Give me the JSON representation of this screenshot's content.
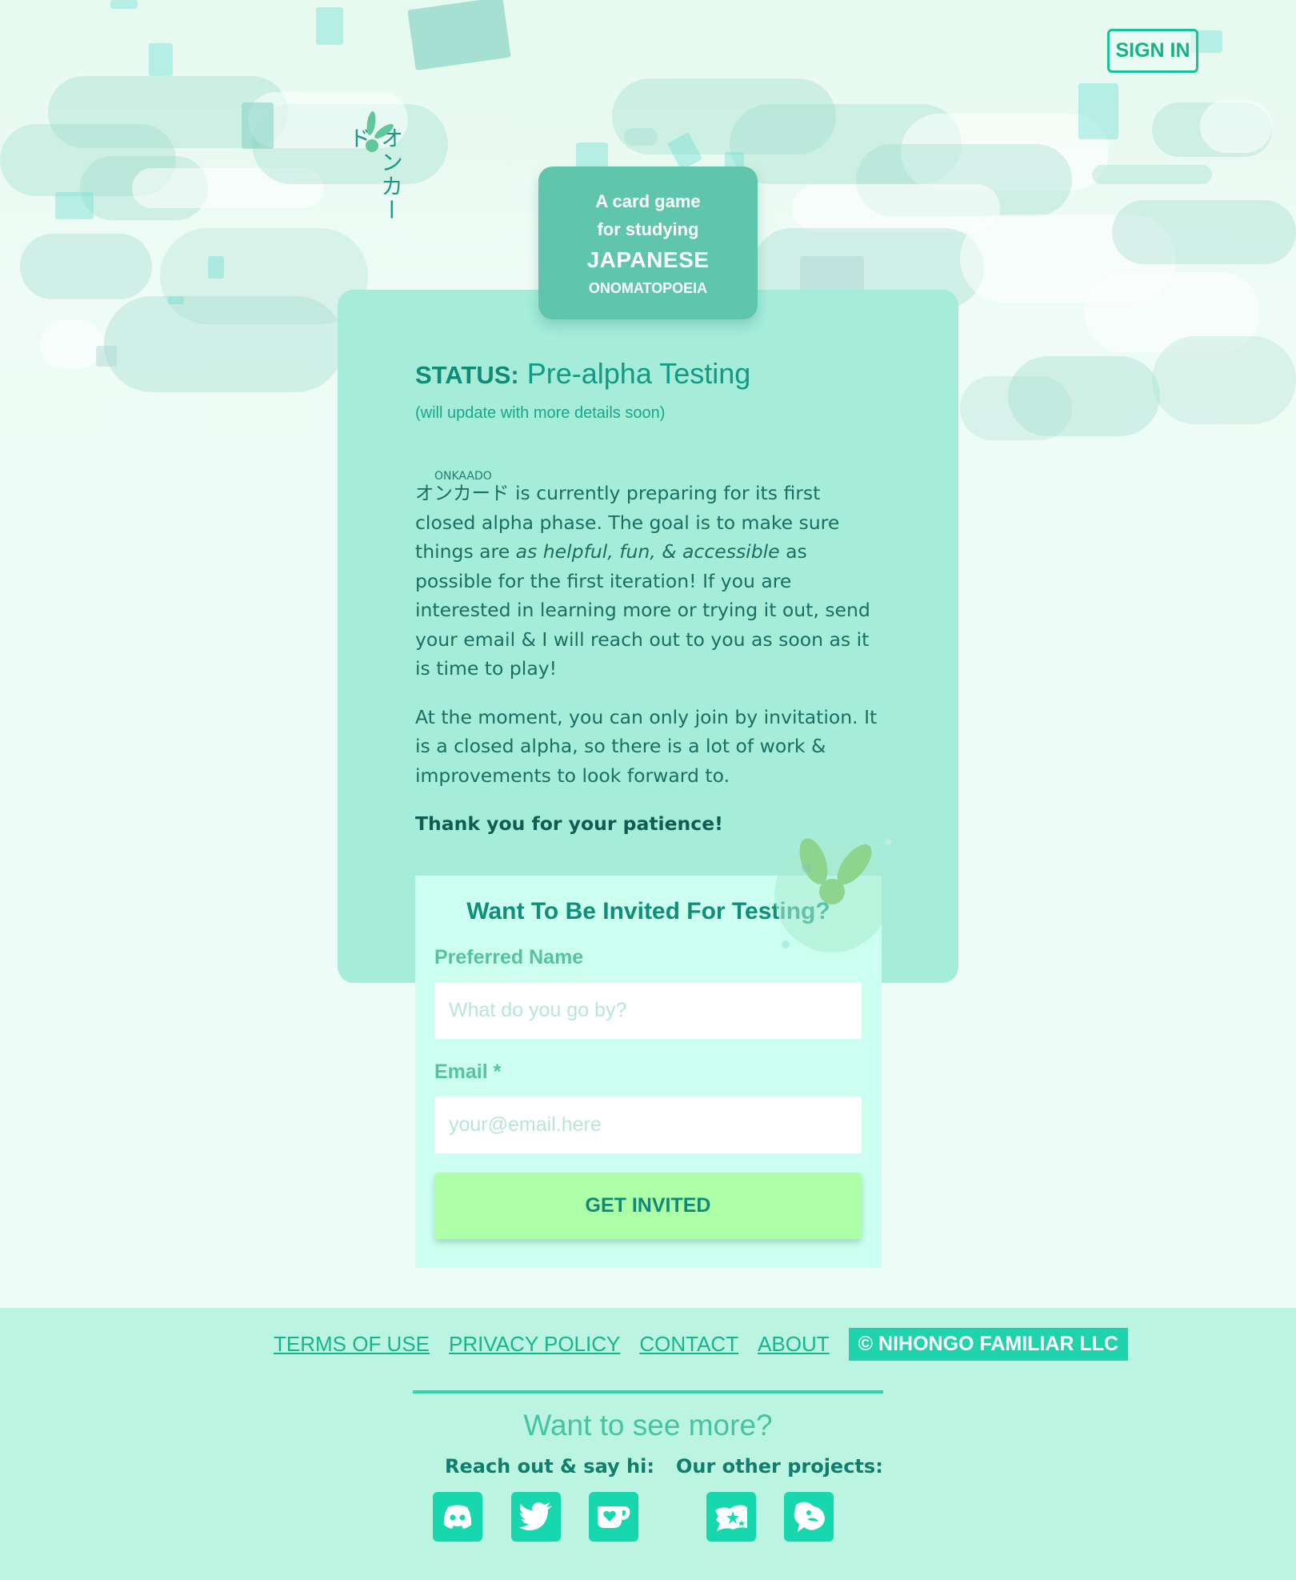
{
  "header": {
    "signin_label": "SIGN IN",
    "logo_text": "オンカード"
  },
  "tagline": {
    "line1": "A card game",
    "line2": "for studying",
    "line3": "JAPANESE",
    "line4": "ONOMATOPOEIA"
  },
  "status": {
    "label": "STATUS:",
    "value": "Pre-alpha Testing",
    "note": "(will update with more details soon)"
  },
  "body": {
    "ruby": "ONKAADO",
    "brand": "オンカード",
    "p1_a": "is currently preparing for its first closed alpha phase. The goal is to make sure things are",
    "p1_em": "as helpful, fun, & accessible",
    "p1_b": "as possible for the first iteration! If you are interested in learning more or trying it out, send your email & I will reach out to you as soon as it is time to play!",
    "p2": "At the moment, you can only join by invitation. It is a closed alpha, so there is a lot of work & improvements to look forward to.",
    "p3": "Thank you for your patience!"
  },
  "form": {
    "title": "Want To Be Invited For Testing?",
    "name_label": "Preferred Name",
    "name_placeholder": "What do you go by?",
    "email_label": "Email *",
    "email_placeholder": "your@email.here",
    "submit_label": "GET INVITED"
  },
  "footer": {
    "links": [
      "TERMS OF USE",
      "PRIVACY POLICY",
      "CONTACT",
      "ABOUT"
    ],
    "copyright": "© NIHONGO FAMILIAR LLC",
    "see_more": "Want to see more?",
    "reach_out": "Reach out & say hi:",
    "other_projects": "Our other projects:",
    "icons": [
      "discord-icon",
      "twitter-icon",
      "kofi-icon",
      "project-stars-icon",
      "project-bird-icon"
    ]
  },
  "colors": {
    "accent": "#19c39a",
    "card": "#a5ecd9",
    "tag": "#5fc6ad",
    "button": "#adffa8",
    "footer": "#bcf4e2"
  }
}
